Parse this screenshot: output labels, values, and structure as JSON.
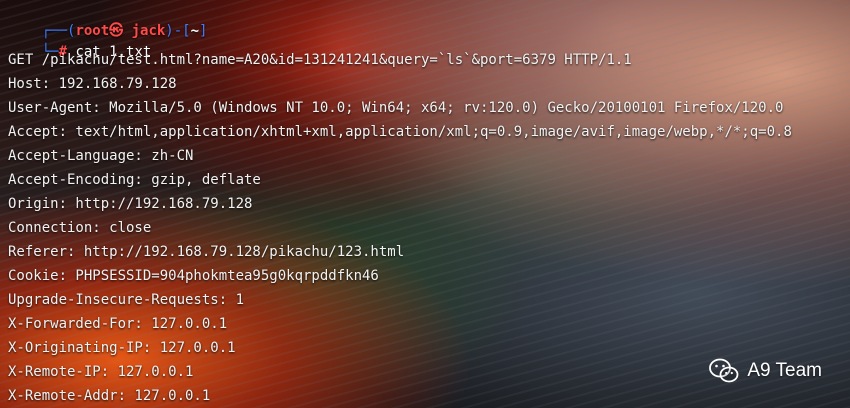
{
  "prompt": {
    "top_prefix": "┌──(",
    "user_host": "root㉿ jack",
    "mid": ")-[",
    "cwd": "~",
    "close": "]",
    "second_prefix": "└─",
    "hash": "#",
    "command": "cat 1.txt"
  },
  "output_lines": [
    "GET /pikachu/test.html?name=A20&id=131241241&query=`ls`&port=6379 HTTP/1.1",
    "Host: 192.168.79.128",
    "User-Agent: Mozilla/5.0 (Windows NT 10.0; Win64; x64; rv:120.0) Gecko/20100101 Firefox/120.0",
    "Accept: text/html,application/xhtml+xml,application/xml;q=0.9,image/avif,image/webp,*/*;q=0.8",
    "Accept-Language: zh-CN",
    "Accept-Encoding: gzip, deflate",
    "Origin: http://192.168.79.128",
    "Connection: close",
    "Referer: http://192.168.79.128/pikachu/123.html",
    "Cookie: PHPSESSID=904phokmtea95g0kqrpddfkn46",
    "Upgrade-Insecure-Requests: 1",
    "X-Forwarded-For: 127.0.0.1",
    "X-Originating-IP: 127.0.0.1",
    "X-Remote-IP: 127.0.0.1",
    "X-Remote-Addr: 127.0.0.1"
  ],
  "watermark": {
    "icon": "wechat-icon",
    "text": "A9 Team"
  },
  "colors": {
    "prompt_bar": "#3f7cff",
    "root": "#ff4a4a",
    "text": "#f2f2f2"
  }
}
